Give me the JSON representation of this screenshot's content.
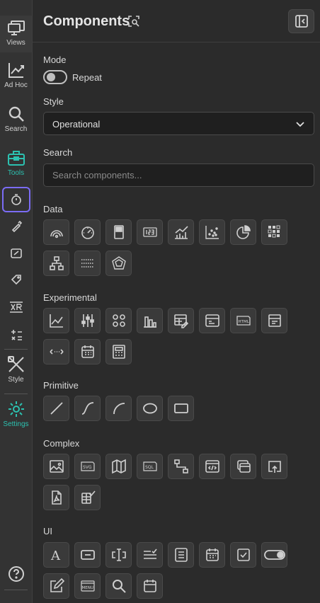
{
  "rail": {
    "items": [
      {
        "label": "Views",
        "icon": "monitor-icon"
      },
      {
        "label": "Ad Hoc",
        "icon": "line-chart-icon"
      },
      {
        "label": "Search",
        "icon": "search-icon"
      },
      {
        "label": "Tools",
        "icon": "toolbox-icon"
      },
      {
        "label": "Style",
        "icon": "pencil-cross-icon"
      },
      {
        "label": "Settings",
        "icon": "gear-icon"
      }
    ],
    "accent": "#2cc1b0",
    "selected_border": "#7b6cf6"
  },
  "panel": {
    "title": "Components",
    "mode_label": "Mode",
    "toggle_label": "Repeat",
    "style_label": "Style",
    "style_value": "Operational",
    "search_label": "Search",
    "search_placeholder": "Search components...",
    "sections": {
      "data": "Data",
      "experimental": "Experimental",
      "primitive": "Primitive",
      "complex": "Complex",
      "ui": "UI"
    }
  }
}
